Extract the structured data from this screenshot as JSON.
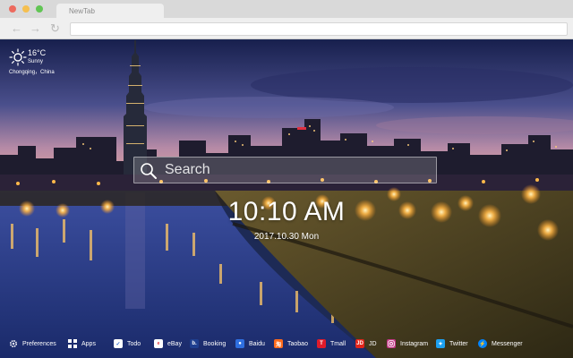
{
  "browser": {
    "tab_title": "NewTab"
  },
  "weather": {
    "temperature": "16°C",
    "condition": "Sunny",
    "location": "Chongqing，China"
  },
  "search": {
    "placeholder": "Search"
  },
  "clock": {
    "time": "10:10 AM",
    "date": "2017.10.30 Mon"
  },
  "bottom_bar": {
    "preferences": "Preferences",
    "apps": "Apps",
    "todo": "Todo",
    "ebay": "eBay",
    "booking": "Booking",
    "baidu": "Baidu",
    "taobao": "Taobao",
    "tmall": "Tmall",
    "jd": "JD",
    "instagram": "Instagram",
    "twitter": "Twitter",
    "messenger": "Messenger"
  },
  "colors": {
    "sky_top": "#1a2050",
    "sky_horizon": "#e0a0a8",
    "river": "#2a3d8c",
    "city_lights": "#ffb94a",
    "booking_icon": "#1f3f8f",
    "baidu_icon": "#2f6fe0",
    "taobao_icon": "#ff6a1a",
    "tmall_icon": "#e01b2a",
    "jd_icon": "#e1251b",
    "instagram_icon": "#c13584",
    "twitter_icon": "#1da1f2",
    "messenger_icon": "#0084ff"
  }
}
